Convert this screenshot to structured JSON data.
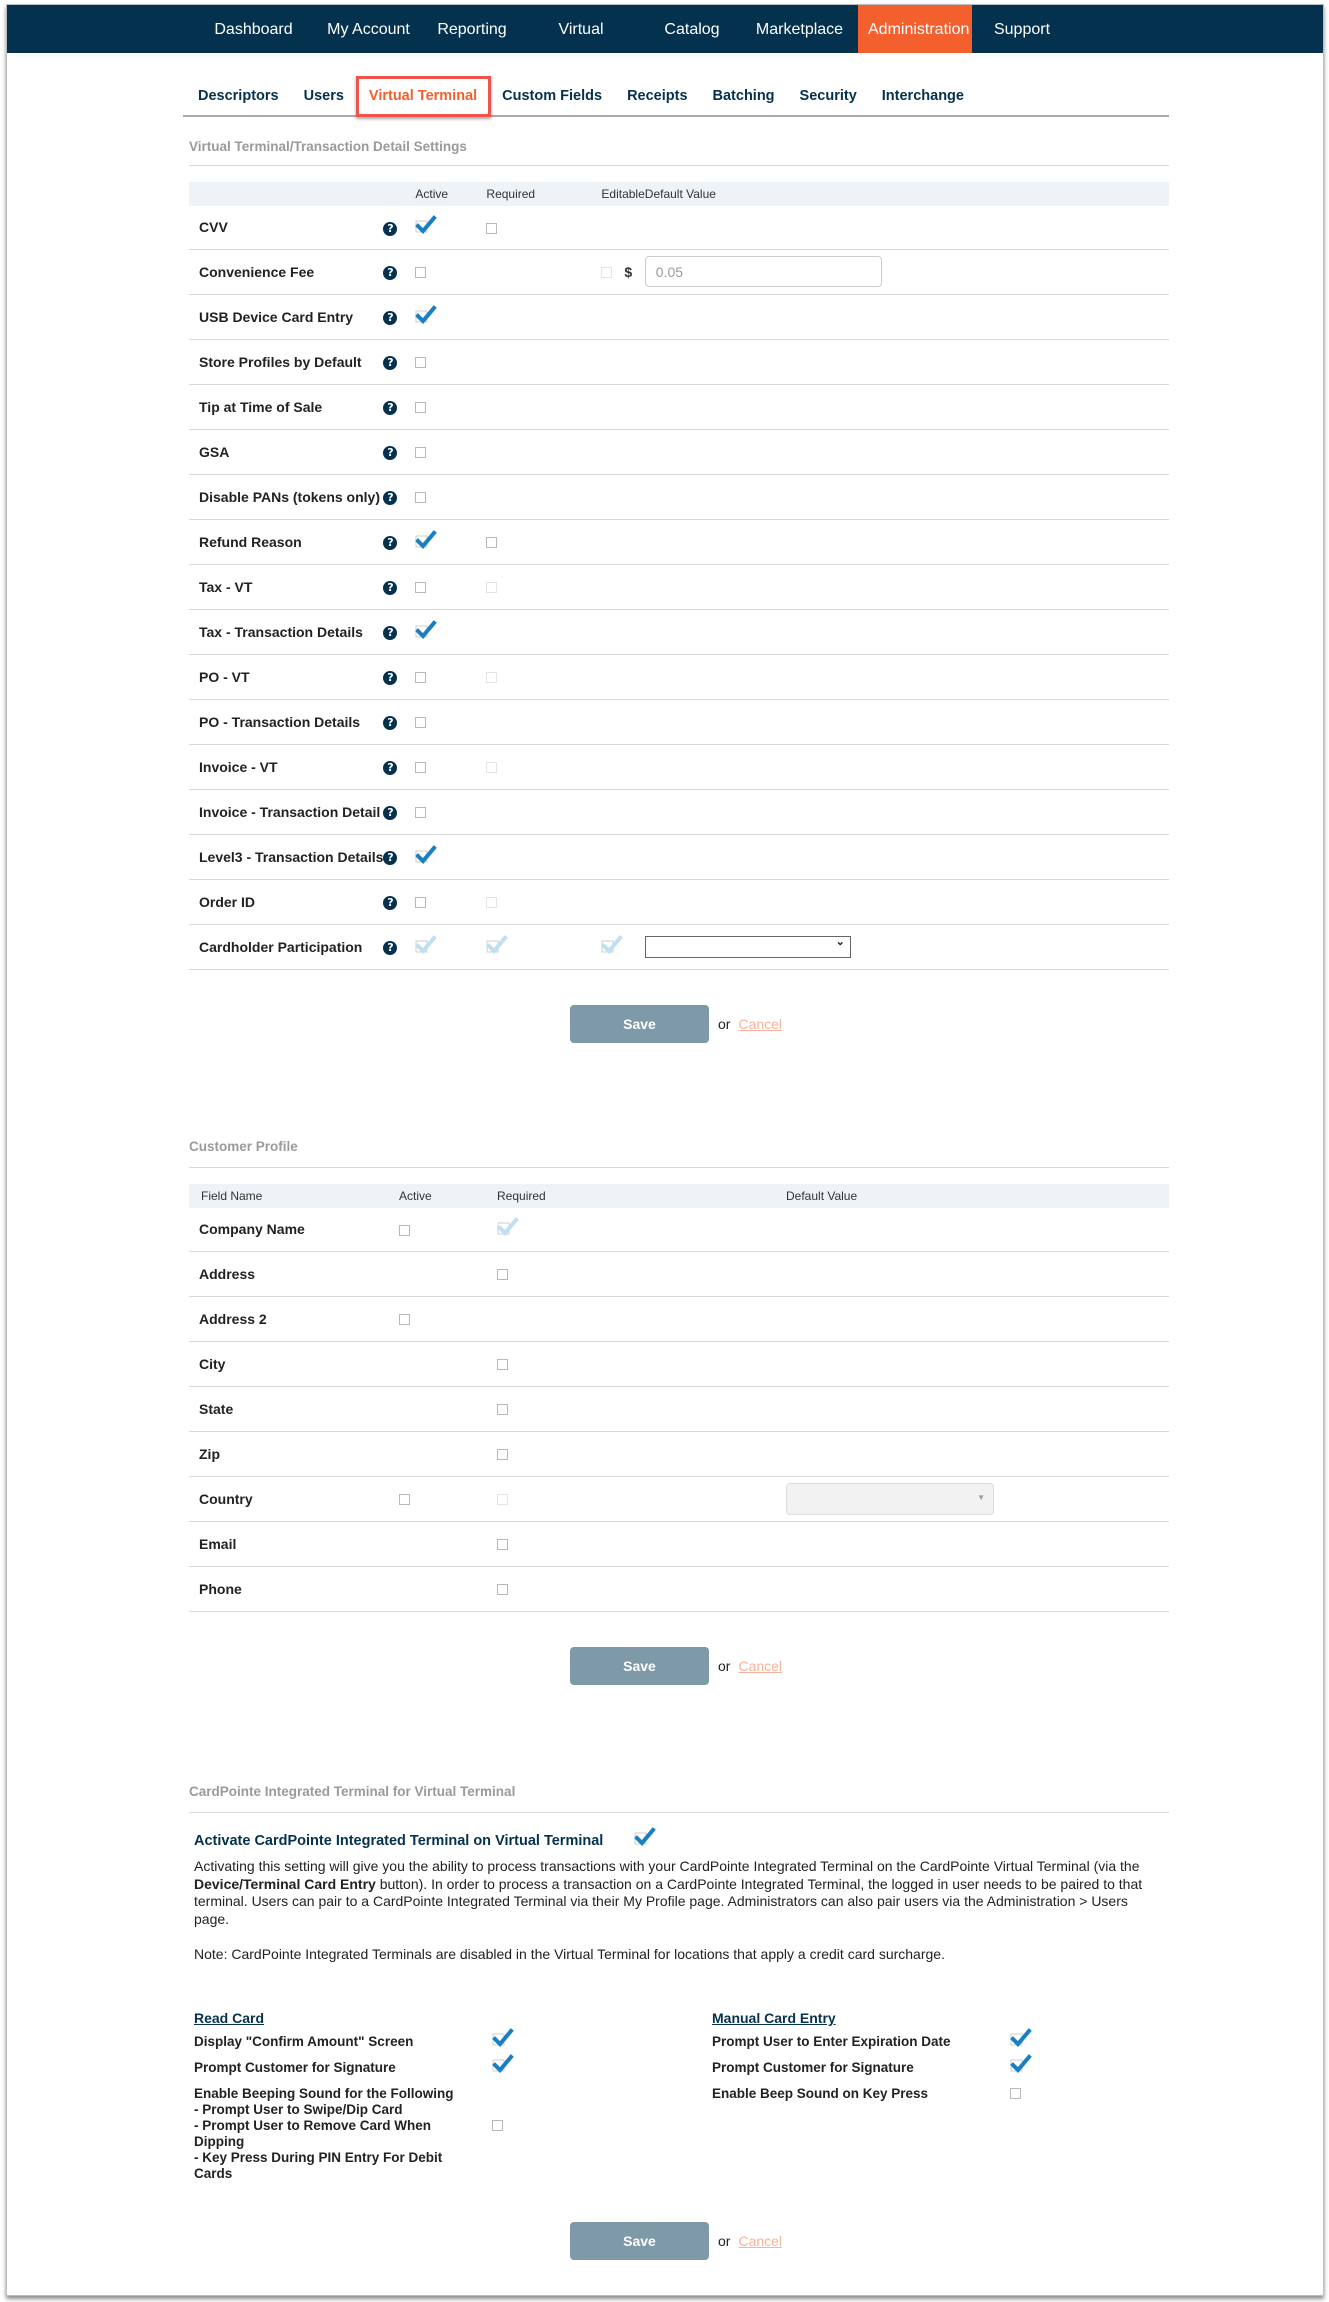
{
  "topnav": {
    "items": [
      {
        "label": "Dashboard",
        "active": false
      },
      {
        "label": "My Account",
        "active": false
      },
      {
        "label": "Reporting",
        "active": false
      },
      {
        "label": "Virtual Terminal",
        "active": false
      },
      {
        "label": "Catalog",
        "active": false
      },
      {
        "label": "Marketplace",
        "active": false
      },
      {
        "label": "Administration",
        "active": true
      },
      {
        "label": "Support",
        "active": false
      }
    ]
  },
  "subnav": {
    "tabs": [
      {
        "label": "Descriptors",
        "active": false
      },
      {
        "label": "Users",
        "active": false
      },
      {
        "label": "Virtual Terminal",
        "active": true
      },
      {
        "label": "Custom Fields",
        "active": false
      },
      {
        "label": "Receipts",
        "active": false
      },
      {
        "label": "Batching",
        "active": false
      },
      {
        "label": "Security",
        "active": false
      },
      {
        "label": "Interchange",
        "active": false
      }
    ]
  },
  "vt_settings": {
    "title": "Virtual Terminal/Transaction Detail Settings",
    "headers": {
      "active": "Active",
      "required": "Required",
      "editable": "Editable",
      "default_value": "Default Value"
    },
    "help_glyph": "?",
    "currency_symbol": "$",
    "rows": [
      {
        "label": "CVV",
        "active": "checked",
        "required": "unchecked",
        "editable": null
      },
      {
        "label": "Convenience Fee",
        "active": "unchecked",
        "required": null,
        "editable": "faint",
        "default_placeholder": "0.05"
      },
      {
        "label": "USB Device Card Entry",
        "active": "checked",
        "required": null,
        "editable": null
      },
      {
        "label": "Store Profiles by Default",
        "active": "unchecked",
        "required": null,
        "editable": null
      },
      {
        "label": "Tip at Time of Sale",
        "active": "unchecked",
        "required": null,
        "editable": null
      },
      {
        "label": "GSA",
        "active": "unchecked",
        "required": null,
        "editable": null
      },
      {
        "label": "Disable PANs (tokens only)",
        "active": "unchecked",
        "required": null,
        "editable": null
      },
      {
        "label": "Refund Reason",
        "active": "checked",
        "required": "unchecked",
        "editable": null
      },
      {
        "label": "Tax - VT",
        "active": "unchecked",
        "required": "faint",
        "editable": null
      },
      {
        "label": "Tax - Transaction Details",
        "active": "checked",
        "required": null,
        "editable": null
      },
      {
        "label": "PO - VT",
        "active": "unchecked",
        "required": "faint",
        "editable": null
      },
      {
        "label": "PO - Transaction Details",
        "active": "unchecked",
        "required": null,
        "editable": null
      },
      {
        "label": "Invoice - VT",
        "active": "unchecked",
        "required": "faint",
        "editable": null
      },
      {
        "label": "Invoice - Transaction Detail",
        "active": "unchecked",
        "required": null,
        "editable": null
      },
      {
        "label": "Level3 - Transaction Details",
        "active": "checked",
        "required": null,
        "editable": null
      },
      {
        "label": "Order ID",
        "active": "unchecked",
        "required": "faint",
        "editable": null
      },
      {
        "label": "Cardholder Participation",
        "active": "checked-faint",
        "required": "checked-faint",
        "editable": "checked-faint",
        "default_select": ""
      }
    ],
    "save_label": "Save",
    "or_label": "or",
    "cancel_label": "Cancel"
  },
  "customer_profile": {
    "title": "Customer Profile",
    "headers": {
      "field_name": "Field Name",
      "active": "Active",
      "required": "Required",
      "default_value": "Default Value"
    },
    "rows": [
      {
        "label": "Company Name",
        "active": "unchecked",
        "required": "checked-faint"
      },
      {
        "label": "Address",
        "active": null,
        "required": "unchecked"
      },
      {
        "label": "Address 2",
        "active": "unchecked",
        "required": null
      },
      {
        "label": "City",
        "active": null,
        "required": "unchecked"
      },
      {
        "label": "State",
        "active": null,
        "required": "unchecked"
      },
      {
        "label": "Zip",
        "active": null,
        "required": "unchecked"
      },
      {
        "label": "Country",
        "active": "unchecked",
        "required": "faint",
        "default_select": ""
      },
      {
        "label": "Email",
        "active": null,
        "required": "unchecked"
      },
      {
        "label": "Phone",
        "active": null,
        "required": "unchecked"
      }
    ],
    "save_label": "Save",
    "or_label": "or",
    "cancel_label": "Cancel"
  },
  "integrated_terminal": {
    "title": "CardPointe Integrated Terminal for Virtual Terminal",
    "activate_label": "Activate CardPointe Integrated Terminal on Virtual Terminal",
    "activate_checked": true,
    "desc_part1": "Activating this setting will give you the ability to process transactions with your CardPointe Integrated Terminal on the CardPointe Virtual Terminal (via the ",
    "desc_bold": "Device/Terminal Card Entry",
    "desc_part2": " button). In order to process a transaction on a CardPointe Integrated Terminal, the logged in user needs to be paired to that terminal. Users can pair to a CardPointe Integrated Terminal via their My Profile page. Administrators can also pair users via the Administration > Users page.",
    "note": "Note: CardPointe Integrated Terminals are disabled in the Virtual Terminal for locations that apply a credit card surcharge.",
    "read_card": {
      "title": "Read Card",
      "options": [
        {
          "label": "Display \"Confirm Amount\" Screen",
          "checked": true
        },
        {
          "label": "Prompt Customer for Signature",
          "checked": true
        },
        {
          "label": "Enable Beeping Sound for the Following\n- Prompt User to Swipe/Dip Card\n- Prompt User to Remove Card When Dipping\n- Key Press During PIN Entry For Debit Cards",
          "checked": false
        }
      ]
    },
    "manual_entry": {
      "title": "Manual Card Entry",
      "options": [
        {
          "label": "Prompt User to Enter Expiration Date",
          "checked": true
        },
        {
          "label": "Prompt Customer for Signature",
          "checked": true
        },
        {
          "label": "Enable Beep Sound on Key Press",
          "checked": false
        }
      ]
    },
    "save_label": "Save",
    "or_label": "or",
    "cancel_label": "Cancel"
  },
  "colors": {
    "nav_bg": "#04314d",
    "accent": "#f4602d",
    "check": "#1a7fc1",
    "check_faint": "#bfe0f0",
    "save_btn": "#7e99a7",
    "cancel": "#f8b19a"
  }
}
